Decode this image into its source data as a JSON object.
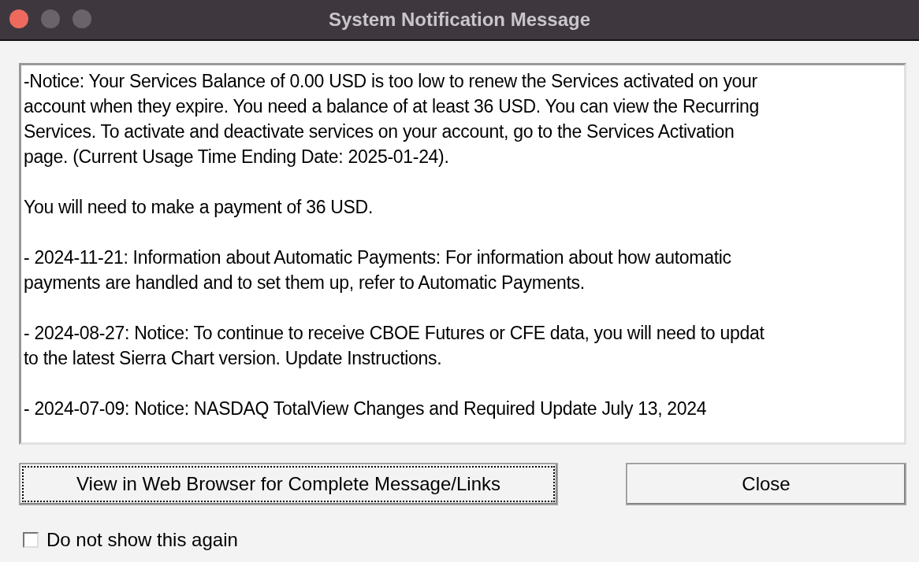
{
  "window": {
    "title": "System Notification Message"
  },
  "message": [
    {
      "lines": [
        "-Notice: Your Services Balance of 0.00 USD is too low to renew the Services activated on your",
        "account when they expire. You need a balance of at least 36 USD. You can view the Recurring",
        "Services. To activate and deactivate services on your account, go to the Services Activation",
        "page. (Current Usage Time Ending Date: 2025-01-24)."
      ]
    },
    {
      "lines": [
        "You will need to make a payment of 36 USD."
      ]
    },
    {
      "lines": [
        "- 2024-11-21: Information about Automatic Payments: For information about how automatic",
        "payments are handled and to set them up, refer to Automatic Payments."
      ]
    },
    {
      "lines": [
        "- 2024-08-27: Notice: To continue to  receive CBOE Futures or CFE data,  you will need to updat",
        "to the latest Sierra Chart version. Update Instructions."
      ]
    },
    {
      "lines": [
        "- 2024-07-09: Notice: NASDAQ TotalView Changes and Required Update July 13, 2024"
      ]
    }
  ],
  "buttons": [
    {
      "label": "View in Web Browser for Complete Message/Links",
      "focused": true
    },
    {
      "label": "Close",
      "focused": false
    }
  ],
  "checkbox": {
    "label": "Do not show this again",
    "checked": false
  }
}
